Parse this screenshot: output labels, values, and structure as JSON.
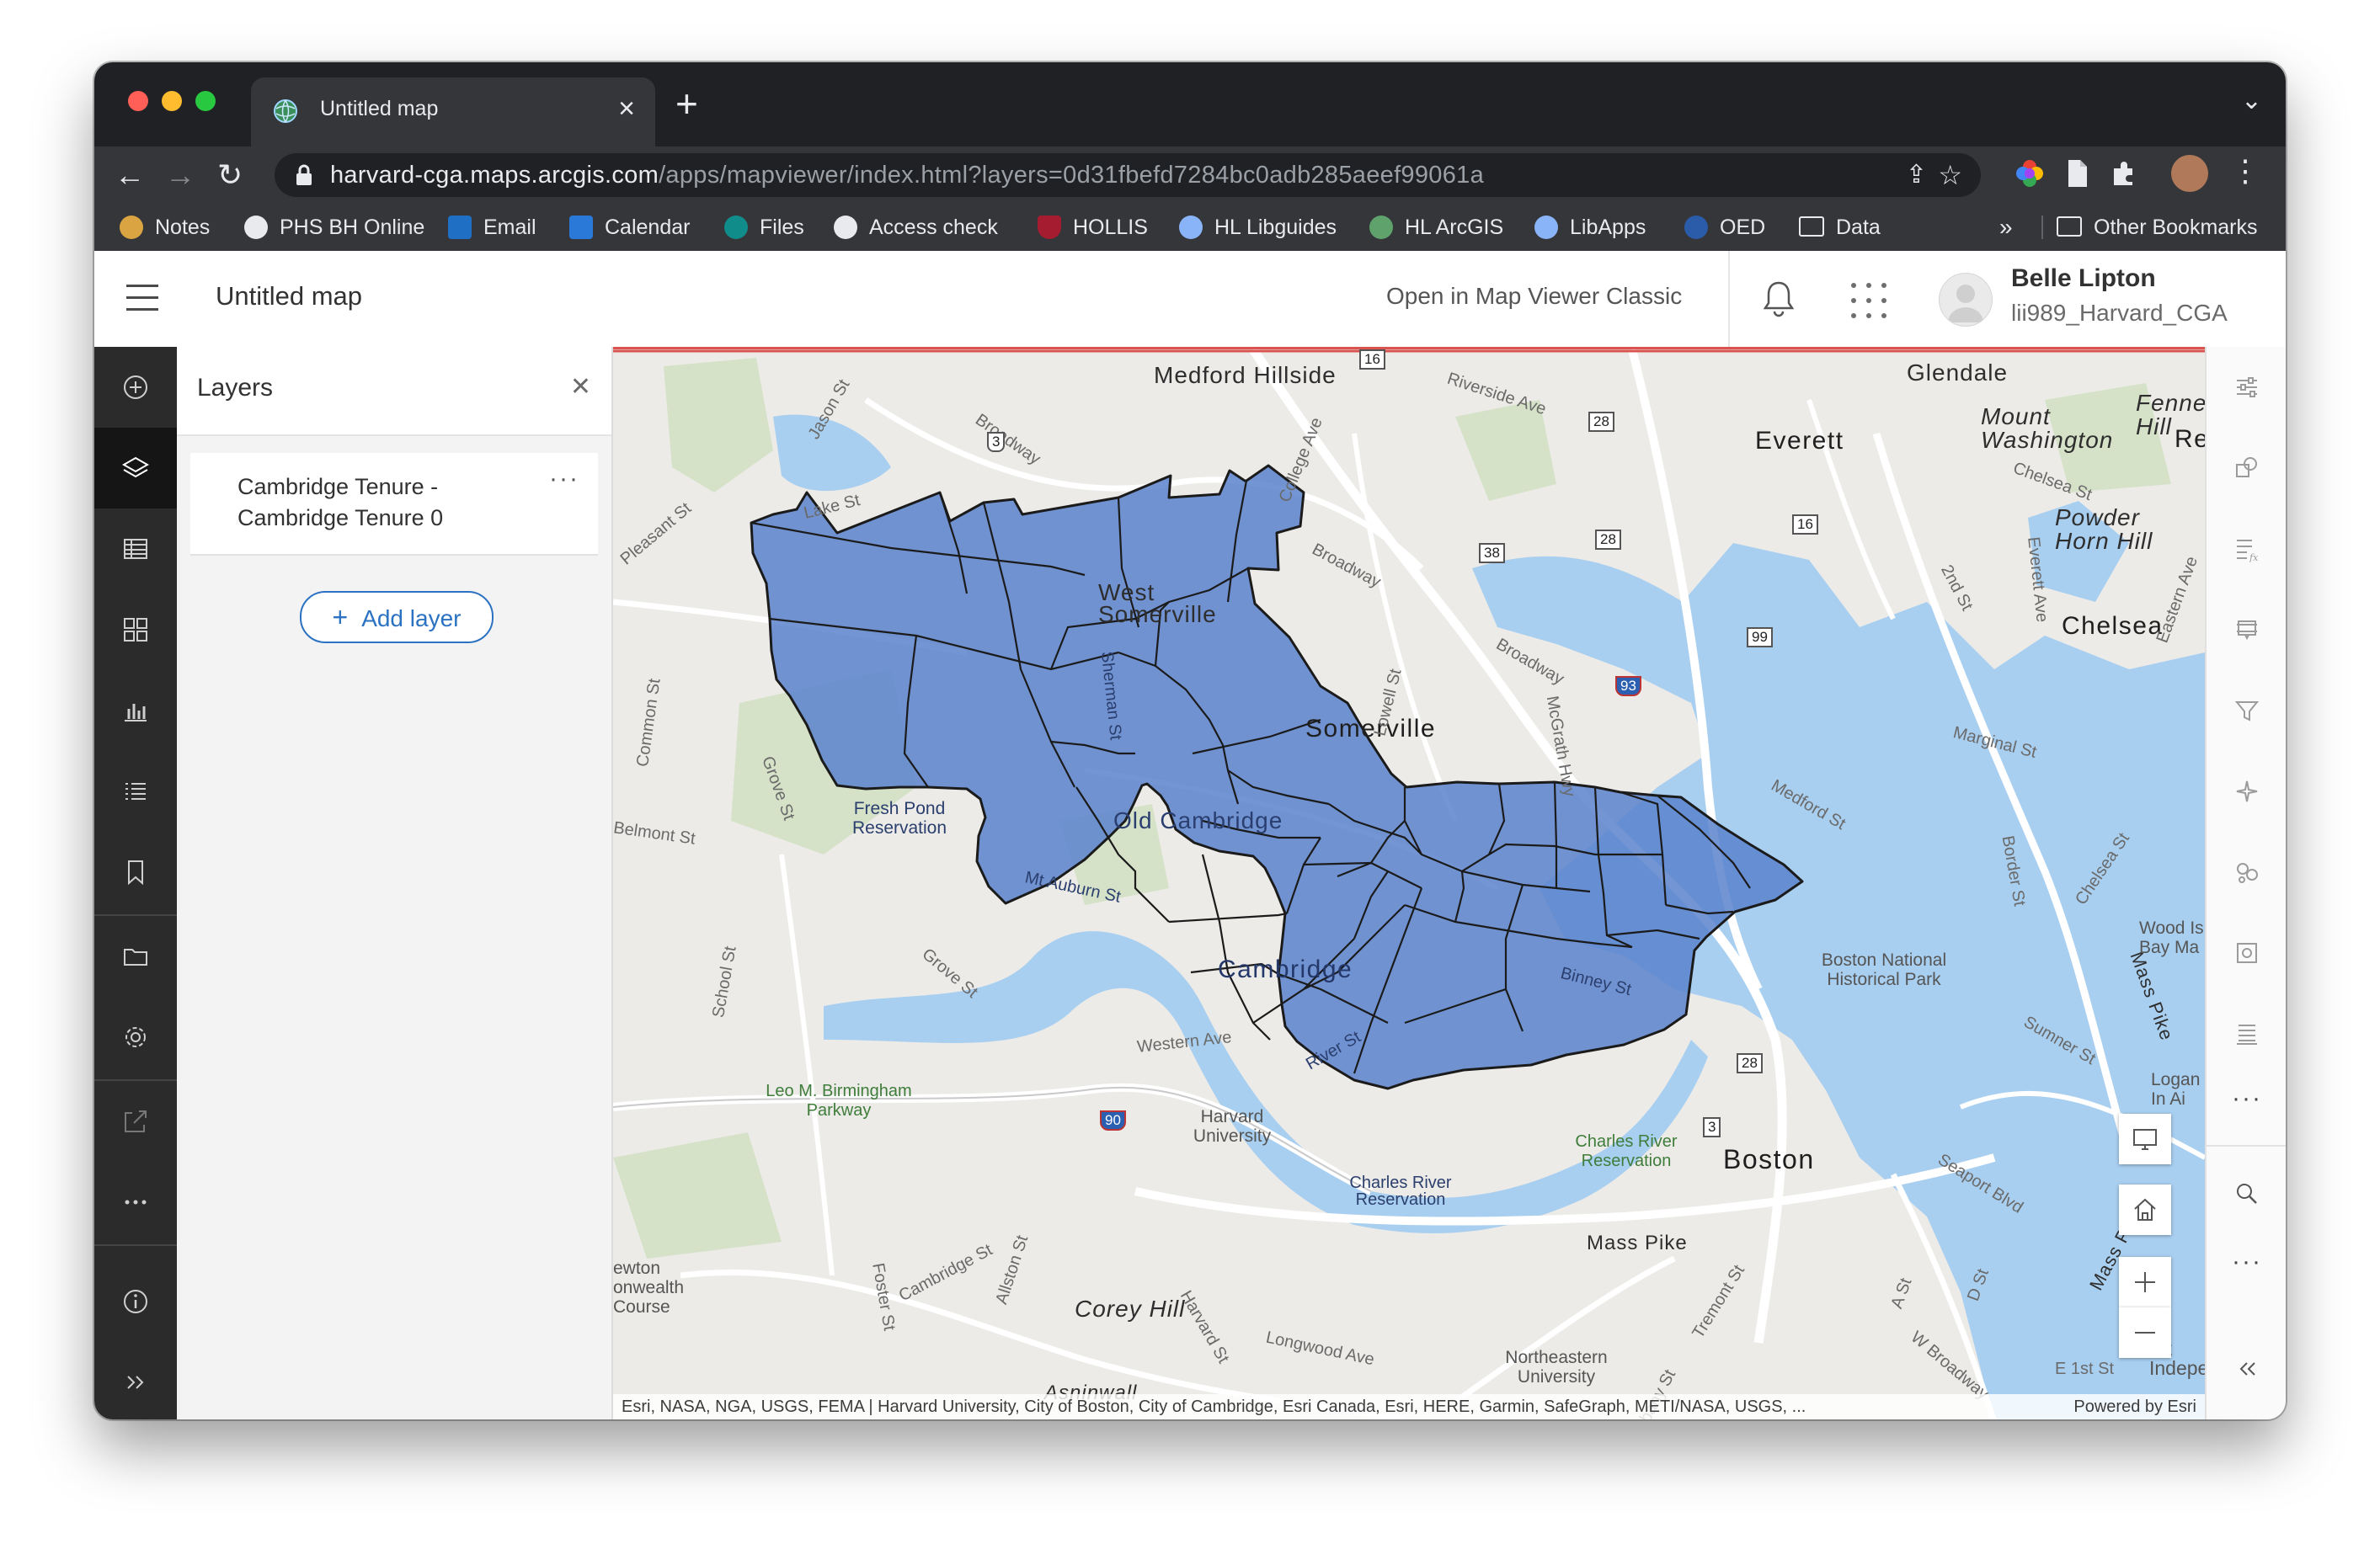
{
  "browser": {
    "tab_title": "Untitled map",
    "url_host": "harvard-cga.maps.arcgis.com",
    "url_path": "/apps/mapviewer/index.html?layers=0d31fbefd7284bc0adb285aeef99061a",
    "bookmarks": [
      {
        "label": "Notes",
        "icon": "notes-icon",
        "color": "#d9a441"
      },
      {
        "label": "PHS BH Online",
        "icon": "globe-icon",
        "color": "#e8eaed"
      },
      {
        "label": "Email",
        "icon": "outlook-icon",
        "color": "#1f6fc5"
      },
      {
        "label": "Calendar",
        "icon": "calendar-icon",
        "color": "#2a79d8"
      },
      {
        "label": "Files",
        "icon": "sharepoint-icon",
        "color": "#108d8a"
      },
      {
        "label": "Access check",
        "icon": "globe-icon",
        "color": "#e8eaed"
      },
      {
        "label": "HOLLIS",
        "icon": "harvard-shield-icon",
        "color": "#a51c30"
      },
      {
        "label": "HL Libguides",
        "icon": "cloud-icon",
        "color": "#8ab4f8"
      },
      {
        "label": "HL ArcGIS",
        "icon": "arcgis-globe-icon",
        "color": "#5fa26b"
      },
      {
        "label": "LibApps",
        "icon": "cloud-icon",
        "color": "#8ab4f8"
      },
      {
        "label": "OED",
        "icon": "oed-icon",
        "color": "#2a5caa"
      },
      {
        "label": "Data",
        "icon": "folder-icon",
        "color": "#e8eaed"
      }
    ],
    "more_bookmarks": "»",
    "other_bookmarks": "Other Bookmarks"
  },
  "app": {
    "map_title": "Untitled map",
    "classic_link": "Open in Map Viewer Classic",
    "user_name": "Belle Lipton",
    "user_id": "lii989_Harvard_CGA"
  },
  "layers_panel": {
    "title": "Layers",
    "layer_name": "Cambridge Tenure - Cambridge Tenure 0",
    "add_layer": "Add layer"
  },
  "map": {
    "labels": {
      "medford_hillside": "Medford Hillside",
      "glendale": "Glendale",
      "everett": "Everett",
      "mount_washington": "Mount Washington",
      "fennes_hill": "Fennes Hill",
      "revere": "Rev",
      "powder_horn_hill": "Powder Horn Hill",
      "chelsea": "Chelsea",
      "west_somerville": "West Somerville",
      "somerville": "Somerville",
      "old_cambridge": "Old Cambridge",
      "cambridge": "Cambridge",
      "boston": "Boston",
      "fresh_pond": "Fresh Pond Reservation",
      "boston_nhp": "Boston National Historical Park",
      "harvard_university": "Harvard University",
      "leo_birmingham": "Leo M. Birmingham Parkway",
      "charles_river_res": "Charles River Reservation",
      "charles_river_res2": "Charles River Reservation",
      "mass_pike": "Mass Pike",
      "mass_pike_v": "Mass Pike",
      "mass_pike_v2": "Mass Pike",
      "corey_hill": "Corey Hill",
      "northeastern": "Northeastern University",
      "newton": "ewton onwealth Course",
      "wood_island": "Wood Is Bay Ma",
      "logan": "Logan In Ai",
      "independence": "ort Indepenc",
      "aspinwall": "Asninwall",
      "lake_st": "Lake St",
      "broadway1": "Broadway",
      "broadway2": "Broadway",
      "broadway3": "Broadway",
      "western_ave": "Western Ave",
      "mt_auburn": "Mt Auburn St",
      "binney_st": "Binney St",
      "river_st": "River St",
      "belmont_st": "Belmont St",
      "grove_st": "Grove St",
      "school_st": "School St",
      "cambridge_st": "Cambridge St",
      "allston_st": "Allston St",
      "foster_st": "Foster St",
      "harvard_st": "Harvard St",
      "longwood_ave": "Longwood Ave",
      "tremont_st": "Tremont St",
      "albany_st": "Albany St",
      "seaport_blvd": "Seaport Blvd",
      "sumner_st": "Sumner St",
      "marginal_st": "Marginal St",
      "chelsea_st": "Chelsea St",
      "medford_st": "Medford St",
      "border_st": "Border St",
      "mcgrath_hwy": "McGrath Hwy",
      "lowell_st": "Lowell St",
      "riverside_ave": "Riverside Ave",
      "college_ave": "College Ave",
      "jason_st": "Jason St",
      "pleasant_st": "Pleasant St",
      "common_st": "Common St",
      "second_st": "2nd St",
      "everett_ave": "Everett Ave",
      "eastern_ave": "Eastern Ave",
      "e_first_st": "E 1st St",
      "w_broadway": "W Broadway",
      "a_st": "A St",
      "d_st": "D St",
      "sherman_st": "Sherman St",
      "chelsea_st2": "Chelsea St",
      "grove_st2": "Grove St"
    },
    "shields": [
      "16",
      "3",
      "28",
      "28",
      "38",
      "16",
      "99",
      "93",
      "28",
      "3",
      "90"
    ],
    "attribution": "Esri, NASA, NGA, USGS, FEMA | Harvard University, City of Boston, City of Cambridge, Esri Canada, Esri, HERE, Garmin, SafeGraph, METI/NASA, USGS, ...",
    "powered_by": "Powered by Esri",
    "polygon_fill": "#5b82cc"
  }
}
